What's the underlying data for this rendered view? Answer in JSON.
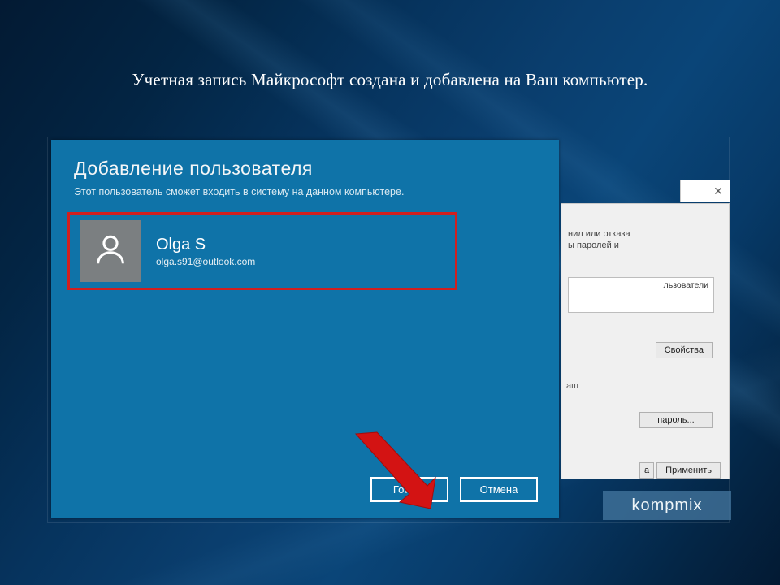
{
  "caption": "Учетная запись Майкрософт создана и добавлена на Ваш компьютер.",
  "modal": {
    "title": "Добавление пользователя",
    "subtitle": "Этот пользователь сможет входить в систему на данном компьютере.",
    "user": {
      "name": "Olga S",
      "email": "olga.s91@outlook.com"
    },
    "buttons": {
      "done": "Готово",
      "cancel": "Отмена"
    }
  },
  "behind": {
    "frag_line1": "нил или отказа",
    "frag_line2": "ы паролей и",
    "users_header": "льзователи",
    "btn_properties": "Свойства",
    "frag_mid": "аш",
    "btn_password": "пароль...",
    "btn_a": "а",
    "btn_apply": "Применить",
    "close_glyph": "✕"
  },
  "watermark": "kompmix"
}
